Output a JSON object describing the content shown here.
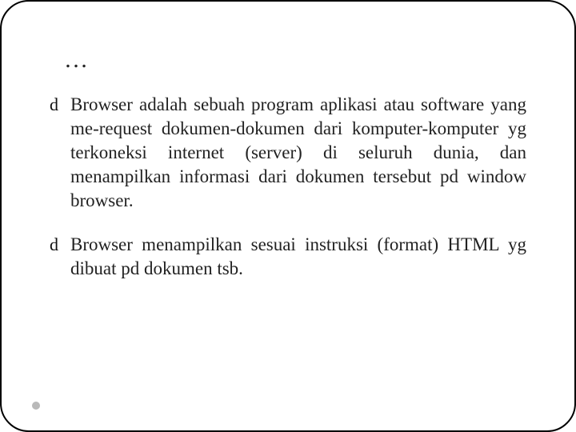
{
  "title": "…",
  "bullets": [
    {
      "icon": "d",
      "text": "Browser adalah sebuah program aplikasi atau software yang me-request dokumen-dokumen dari komputer-komputer yg terkoneksi internet (server) di seluruh dunia, dan menampilkan informasi dari dokumen tersebut pd window browser."
    },
    {
      "icon": "d",
      "text": "Browser menampilkan sesuai instruksi (format) HTML yg dibuat pd dokumen tsb."
    }
  ]
}
